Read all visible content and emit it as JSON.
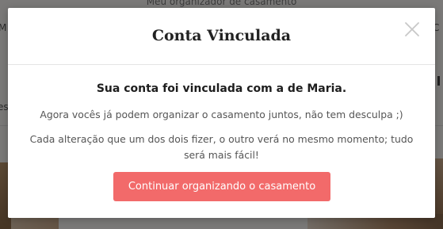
{
  "background": {
    "header_text": "Meu organizador de casamento",
    "left_fragment": "M",
    "right_fragment": "C",
    "mid_left_fragment": "es"
  },
  "modal": {
    "title": "Conta Vinculada",
    "close_icon": "close-icon",
    "headline": "Sua conta foi vinculada com a de Maria.",
    "line1": "Agora vocês já podem organizar o casamento juntos, não tem desculpa ;)",
    "line2": "Cada alteração que um dos dois fizer, o outro verá no mesmo momento; tudo será mais fácil!",
    "button_label": "Continuar organizando o casamento",
    "accent_color": "#f26a6a"
  }
}
